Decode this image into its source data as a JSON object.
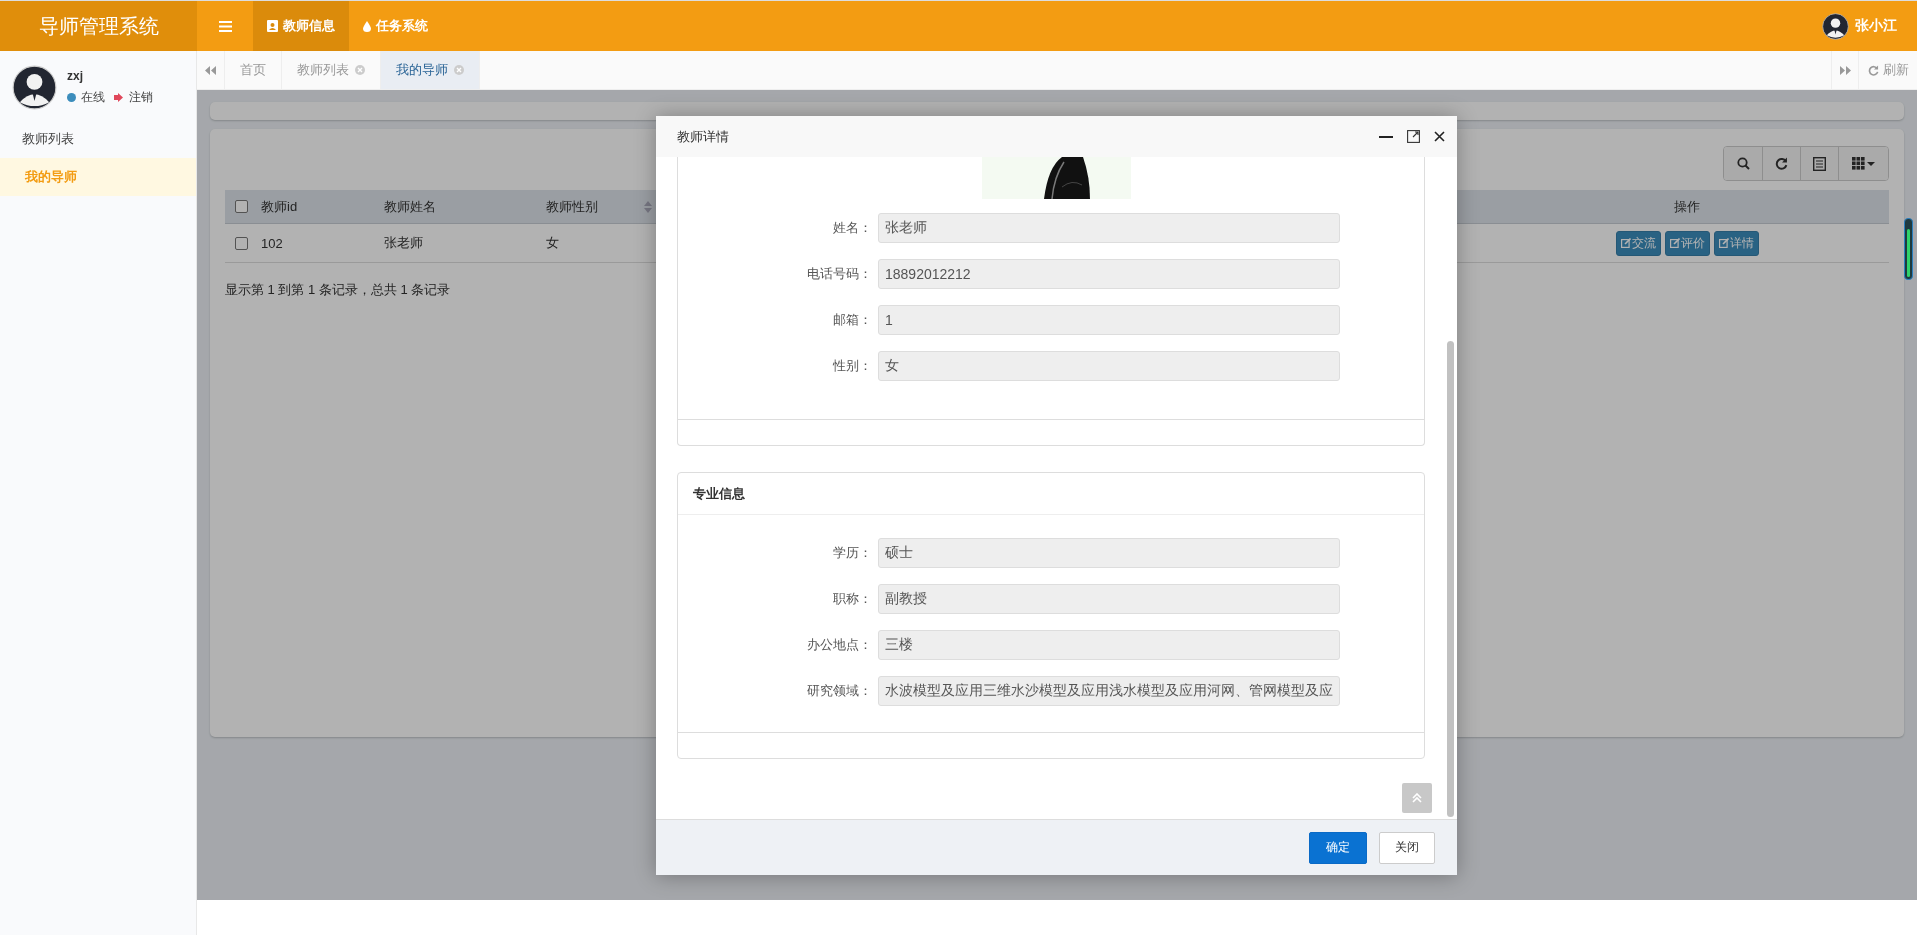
{
  "app": {
    "title": "导师管理系统"
  },
  "top_nav": {
    "items": [
      {
        "label": "教师信息",
        "selected": true
      },
      {
        "label": "任务系统",
        "selected": false
      }
    ],
    "user": "张小江"
  },
  "sidebar": {
    "user": {
      "name": "zxj",
      "status": "在线",
      "logout": "注销"
    },
    "menu": [
      {
        "label": "教师列表",
        "selected": false
      },
      {
        "label": "我的导师",
        "selected": true
      }
    ]
  },
  "tabs": {
    "items": [
      {
        "label": "首页",
        "closable": false,
        "selected": false
      },
      {
        "label": "教师列表",
        "closable": true,
        "selected": false
      },
      {
        "label": "我的导师",
        "closable": true,
        "selected": true
      }
    ],
    "refresh": "刷新"
  },
  "table": {
    "header_checked": false,
    "columns": [
      {
        "label": "教师id",
        "sortable": false
      },
      {
        "label": "教师姓名",
        "sortable": false
      },
      {
        "label": "教师性别",
        "sortable": true
      },
      {
        "label": "操作",
        "sortable": false
      }
    ],
    "rows": [
      {
        "checked": false,
        "cells": [
          "102",
          "张老师",
          "女"
        ],
        "actions": [
          "交流",
          "评价",
          "详情"
        ]
      }
    ],
    "summary": "显示第 1 到第 1 条记录，总共 1 条记录"
  },
  "dialog": {
    "title": "教师详情",
    "sections": [
      {
        "picture": true,
        "fields": [
          {
            "label": "姓名：",
            "value": "张老师"
          },
          {
            "label": "电话号码：",
            "value": "18892012212"
          },
          {
            "label": "邮箱：",
            "value": "1"
          },
          {
            "label": "性别：",
            "value": "女"
          }
        ]
      },
      {
        "title": "专业信息",
        "picture": false,
        "fields": [
          {
            "label": "学历：",
            "value": "硕士"
          },
          {
            "label": "职称：",
            "value": "副教授"
          },
          {
            "label": "办公地点：",
            "value": "三楼"
          },
          {
            "label": "研究领域：",
            "value": "水波模型及应用三维水沙模型及应用浅水模型及应用河网、管网模型及应"
          }
        ]
      }
    ],
    "buttons": [
      {
        "label": "确定",
        "kind": "primary"
      },
      {
        "label": "关闭",
        "kind": "default"
      }
    ]
  }
}
